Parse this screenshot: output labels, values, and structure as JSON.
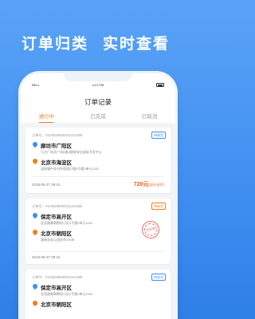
{
  "promo": {
    "left": "订单归类",
    "right": "实时查看"
  },
  "status": {
    "carrier": "BELL",
    "time": "4:21 PM"
  },
  "header": {
    "title": "订单记录"
  },
  "tabs": [
    {
      "label": "进行中",
      "active": true
    },
    {
      "label": "已完成",
      "active": false
    },
    {
      "label": "已取消",
      "active": false
    }
  ],
  "orders": [
    {
      "order_no": "订单号：#1235286663331212489",
      "badge": "待装货",
      "from_city": "廊坊市广阳区",
      "from_addr": "万达广场北广场B座6楼联安信诚安开发中心",
      "to_city": "北京市海淀区",
      "to_addr": "温泉镇中关村环保园小镇2号楼3单元1302",
      "time": "2019-05-27  09:10",
      "price": "720元",
      "price_note": "(部分支付)"
    },
    {
      "order_no": "订单号：#1235286663331212489",
      "badge": "待卸货",
      "from_city": "保定市高开区",
      "from_addr": "金苑路春朝朝阳小区2号楼3单元1042",
      "to_city": "北京市朝阳区",
      "to_addr": "满林花苑公园向东200米",
      "time": "2019-05-27  09:10",
      "stamp": "已签收"
    },
    {
      "order_no": "订单号：#1235286663331212489",
      "badge": "待发车",
      "from_city": "保定市高开区",
      "from_addr": "金苑路春朝朝阳小区2号楼3单元1042",
      "to_city": "北京市朝阳区",
      "to_addr": ""
    }
  ]
}
